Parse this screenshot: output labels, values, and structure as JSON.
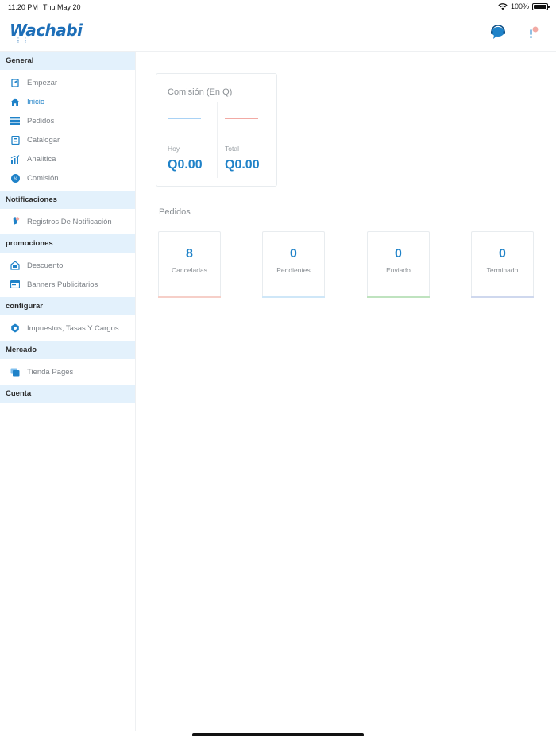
{
  "status_bar": {
    "time": "11:20 PM",
    "date": "Thu May 20",
    "battery": "100%"
  },
  "header": {
    "logo": "Wachabi",
    "logo_mark": "⋮⋮"
  },
  "sidebar": {
    "sections": [
      {
        "title": "General",
        "items": [
          {
            "label": "Empezar",
            "icon": "rocket-icon"
          },
          {
            "label": "Inicio",
            "icon": "home-icon",
            "active": true
          },
          {
            "label": "Pedidos",
            "icon": "orders-icon"
          },
          {
            "label": "Catalogar",
            "icon": "catalog-icon"
          },
          {
            "label": "Analítica",
            "icon": "analytics-icon"
          },
          {
            "label": "Comisión",
            "icon": "percent-icon"
          }
        ]
      },
      {
        "title": "Notificaciones",
        "items": [
          {
            "label": "Registros De Notificación",
            "icon": "bell-icon"
          }
        ]
      },
      {
        "title": "promociones",
        "items": [
          {
            "label": "Descuento",
            "icon": "discount-icon"
          },
          {
            "label": "Banners Publicitarios",
            "icon": "banner-icon"
          }
        ]
      },
      {
        "title": "configurar",
        "items": [
          {
            "label": "Impuestos, Tasas Y Cargos",
            "icon": "settings-icon"
          }
        ]
      },
      {
        "title": "Mercado",
        "items": [
          {
            "label": "Tienda Pages",
            "icon": "pages-icon"
          }
        ]
      },
      {
        "title": "Cuenta",
        "items": []
      }
    ]
  },
  "commission": {
    "title": "Comisión (En Q)",
    "today_label": "Hoy",
    "today_value": "Q0.00",
    "total_label": "Total",
    "total_value": "Q0.00"
  },
  "orders": {
    "title": "Pedidos",
    "stats": [
      {
        "value": "8",
        "label": "Canceladas",
        "color": "#f6cfc8"
      },
      {
        "value": "0",
        "label": "Pendientes",
        "color": "#cfe7f8"
      },
      {
        "value": "0",
        "label": "Enviado",
        "color": "#bfe3bf"
      },
      {
        "value": "0",
        "label": "Terminado",
        "color": "#cfd8ee"
      }
    ]
  },
  "colors": {
    "accent": "#1f82c8",
    "section_bg": "#e3f1fc",
    "logo": "#1e6fb8"
  }
}
